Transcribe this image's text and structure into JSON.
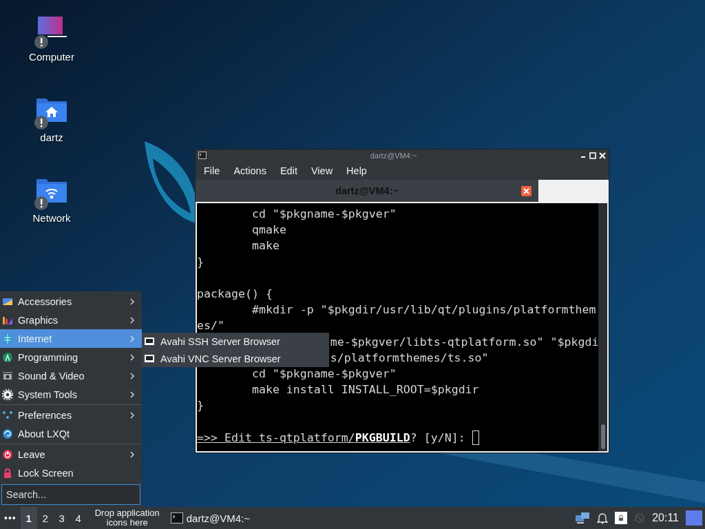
{
  "desktop_icons": [
    {
      "label": "Computer",
      "warning": true
    },
    {
      "label": "dartz",
      "warning": true
    },
    {
      "label": "Network",
      "warning": true
    }
  ],
  "terminal": {
    "window_title": "dartz@VM4:~",
    "menu": [
      "File",
      "Actions",
      "Edit",
      "View",
      "Help"
    ],
    "tabs": [
      {
        "label": "dartz@VM4:~",
        "selected": true
      }
    ],
    "lines": [
      {
        "kind": "text",
        "text": "        cd \"$pkgname-$pkgver\""
      },
      {
        "kind": "text",
        "text": "        qmake"
      },
      {
        "kind": "text",
        "text": "        make"
      },
      {
        "kind": "text",
        "text": "}"
      },
      {
        "kind": "blank"
      },
      {
        "kind": "text",
        "text": "package() {"
      },
      {
        "kind": "text",
        "text": "        #mkdir -p \"$pkgdir/usr/lib/qt/plugins/platformthem"
      },
      {
        "kind": "text",
        "text": "es/\""
      },
      {
        "kind": "covered",
        "text": "me-$pkgver/libts-qtplatform.so\" \"$pkgdi"
      },
      {
        "kind": "covered",
        "text": "s/platformthemes/ts.so\""
      },
      {
        "kind": "text",
        "text": "        cd \"$pkgname-$pkgver\""
      },
      {
        "kind": "text",
        "text": "        make install INSTALL_ROOT=$pkgdir"
      },
      {
        "kind": "text",
        "text": "}"
      },
      {
        "kind": "blank"
      }
    ],
    "prompt": {
      "underlined": "=>> Edit ts-qtplatform/**PKGBUILD**",
      "rest": "? [y/N]:",
      "cursor": true
    }
  },
  "start_menu": {
    "groups": [
      {
        "items": [
          {
            "label": "Accessories",
            "selected": false,
            "submenu": true
          },
          {
            "label": "Graphics",
            "selected": false,
            "submenu": true
          },
          {
            "label": "Internet",
            "selected": true,
            "submenu": true
          },
          {
            "label": "Programming",
            "selected": false,
            "submenu": true
          },
          {
            "label": "Sound & Video",
            "selected": false,
            "submenu": true
          },
          {
            "label": "System Tools",
            "selected": false,
            "submenu": true
          }
        ]
      },
      {
        "items": [
          {
            "label": "Preferences",
            "selected": false,
            "submenu": true
          },
          {
            "label": "About LXQt",
            "selected": false,
            "submenu": false
          }
        ]
      },
      {
        "items": [
          {
            "label": "Leave",
            "selected": false,
            "submenu": true
          },
          {
            "label": "Lock Screen",
            "selected": false,
            "submenu": false
          }
        ]
      }
    ],
    "search": {
      "placeholder": "Search..."
    },
    "submenu": [
      {
        "label": "Avahi SSH Server Browser"
      },
      {
        "label": "Avahi VNC Server Browser"
      }
    ]
  },
  "taskbar": {
    "menu_button": "•••",
    "desktops": [
      {
        "label": "1",
        "selected": true
      },
      {
        "label": "2",
        "selected": false
      },
      {
        "label": "3",
        "selected": false
      },
      {
        "label": "4",
        "selected": false
      }
    ],
    "quicklaunch_hint": "Drop application icons here",
    "tasks": [
      {
        "label": "dartz@VM4:~"
      }
    ],
    "clock": "20:11"
  }
}
